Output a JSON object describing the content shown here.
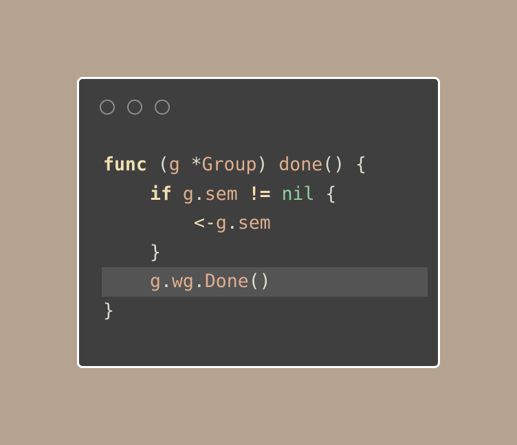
{
  "window": {
    "controls": [
      "window-dot",
      "window-dot",
      "window-dot"
    ]
  },
  "code": {
    "language": "go",
    "lines": [
      {
        "indent": 0,
        "highlighted": false,
        "tokens": [
          {
            "text": "func",
            "kind": "keyword"
          },
          {
            "text": " (",
            "kind": "punct"
          },
          {
            "text": "g",
            "kind": "ident"
          },
          {
            "text": " *",
            "kind": "punct"
          },
          {
            "text": "Group",
            "kind": "ident"
          },
          {
            "text": ") ",
            "kind": "punct"
          },
          {
            "text": "done",
            "kind": "ident"
          },
          {
            "text": "() {",
            "kind": "punct"
          }
        ]
      },
      {
        "indent": 1,
        "highlighted": false,
        "tokens": [
          {
            "text": "if",
            "kind": "keyword"
          },
          {
            "text": " ",
            "kind": "punct"
          },
          {
            "text": "g",
            "kind": "ident"
          },
          {
            "text": ".",
            "kind": "punct"
          },
          {
            "text": "sem",
            "kind": "ident"
          },
          {
            "text": " ",
            "kind": "punct"
          },
          {
            "text": "!=",
            "kind": "keyword"
          },
          {
            "text": " ",
            "kind": "punct"
          },
          {
            "text": "nil",
            "kind": "constant"
          },
          {
            "text": " {",
            "kind": "punct"
          }
        ]
      },
      {
        "indent": 2,
        "highlighted": false,
        "tokens": [
          {
            "text": "<-",
            "kind": "operator"
          },
          {
            "text": "g",
            "kind": "ident"
          },
          {
            "text": ".",
            "kind": "punct"
          },
          {
            "text": "sem",
            "kind": "ident"
          }
        ]
      },
      {
        "indent": 1,
        "highlighted": false,
        "tokens": [
          {
            "text": "}",
            "kind": "punct"
          }
        ]
      },
      {
        "indent": 1,
        "highlighted": true,
        "tokens": [
          {
            "text": "g",
            "kind": "ident"
          },
          {
            "text": ".",
            "kind": "punct"
          },
          {
            "text": "wg",
            "kind": "ident"
          },
          {
            "text": ".",
            "kind": "punct"
          },
          {
            "text": "Done",
            "kind": "ident"
          },
          {
            "text": "()",
            "kind": "punct"
          }
        ]
      },
      {
        "indent": 0,
        "highlighted": false,
        "tokens": [
          {
            "text": "}",
            "kind": "punct"
          }
        ]
      }
    ]
  },
  "colors": {
    "background": "#b5a392",
    "window": "#3f3f3f",
    "window_border": "#ffffff",
    "highlight": "#545454",
    "keyword": "#f0dfaf",
    "ident": "#dfaf8f",
    "constant": "#8fcfa0",
    "punct": "#dcdccc"
  }
}
